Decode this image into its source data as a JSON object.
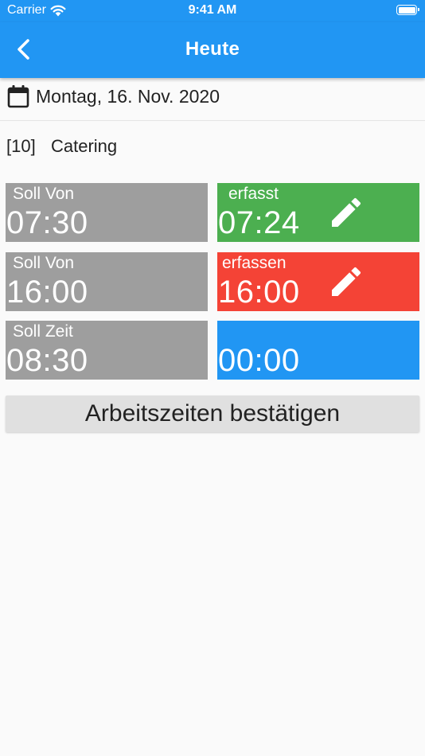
{
  "status_bar": {
    "carrier": "Carrier",
    "time": "9:41 AM"
  },
  "app_bar": {
    "title": "Heute"
  },
  "date_row": {
    "date": "Montag, 16. Nov. 2020"
  },
  "project": {
    "id": "[10]",
    "name": "Catering"
  },
  "rows": [
    {
      "planned_label": "Soll Von",
      "planned_value": "07:30",
      "actual_label": "erfasst",
      "actual_value": "07:24"
    },
    {
      "planned_label": "Soll Von",
      "planned_value": "16:00",
      "actual_label": "erfassen",
      "actual_value": "16:00"
    },
    {
      "planned_label": "Soll Zeit",
      "planned_value": "08:30",
      "actual_label": "",
      "actual_value": "00:00"
    }
  ],
  "confirm_button": {
    "label": "Arbeitszeiten bestätigen"
  },
  "icons": {
    "back": "chevron-left-icon",
    "calendar": "calendar-icon",
    "edit": "pencil-icon",
    "wifi": "wifi-icon",
    "battery": "battery-icon"
  },
  "colors": {
    "primary": "#2196f3",
    "planned_tile": "#9e9e9e",
    "recorded_tile": "#4caf50",
    "to_record_tile": "#f44336",
    "total_tile": "#2196f3",
    "button": "#e0e0e0"
  }
}
